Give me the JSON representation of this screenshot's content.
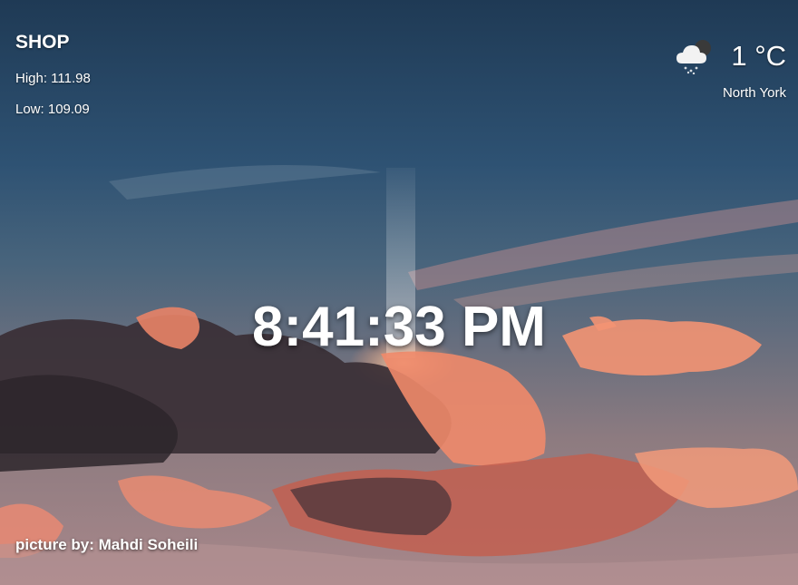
{
  "stock": {
    "symbol": "SHOP",
    "high": "High: 111.98",
    "low": "Low: 109.09"
  },
  "weather": {
    "icon": "cloud-snow-moon-icon",
    "temperature": "1 °C",
    "location": "North York"
  },
  "clock": {
    "time": "8:41:33 PM"
  },
  "credit": {
    "text": "picture by: Mahdi Soheili"
  },
  "background": {
    "description_icon": "sky-sunset-moon-clouds-image",
    "sky_top": "#1f3a55",
    "cloud_accent": "#f08a6a"
  }
}
